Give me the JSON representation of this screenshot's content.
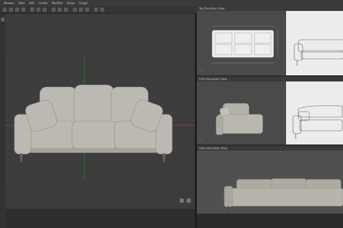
{
  "menubar": {
    "items": [
      "Browse",
      "Tools",
      "Edit",
      "Create",
      "Modifier",
      "Views",
      "Graph"
    ]
  },
  "panels": {
    "top": {
      "title": "Top Elevation View"
    },
    "front": {
      "title": "Front Elevation View"
    },
    "side": {
      "title": "Sides Elevation View"
    }
  },
  "icons": {
    "menu": "menu-icon",
    "gizmo": "axis-gizmo-icon"
  },
  "colors": {
    "viewport_bg": "#3c3c3c",
    "grid": "#4c4c4c",
    "sofa_fabric": "#b7b4ad",
    "accent_red": "#c0392b",
    "accent_green": "#2e8b3a"
  }
}
